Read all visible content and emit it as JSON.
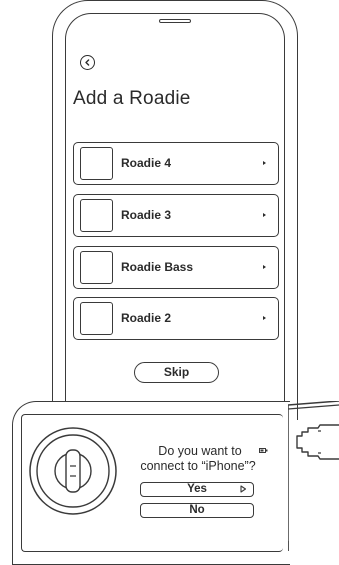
{
  "screen": {
    "title": "Add a Roadie",
    "back_icon": "chevron-left-icon",
    "devices": [
      {
        "label": "Roadie 4",
        "icon": "chevron-right-icon"
      },
      {
        "label": "Roadie 3",
        "icon": "chevron-right-icon"
      },
      {
        "label": "Roadie Bass",
        "icon": "chevron-right-icon"
      },
      {
        "label": "Roadie 2",
        "icon": "chevron-right-icon"
      }
    ],
    "skip_label": "Skip"
  },
  "hardware": {
    "prompt_line1": "Do you want to",
    "prompt_line2": "connect to “iPhone”?",
    "yes_label": "Yes",
    "no_label": "No",
    "selection_icon": "play-arrow-icon",
    "knob_icon": "tuning-knob-icon"
  },
  "colors": {
    "stroke": "#3a3a3a",
    "text": "#2b2b2b",
    "background": "#ffffff"
  }
}
